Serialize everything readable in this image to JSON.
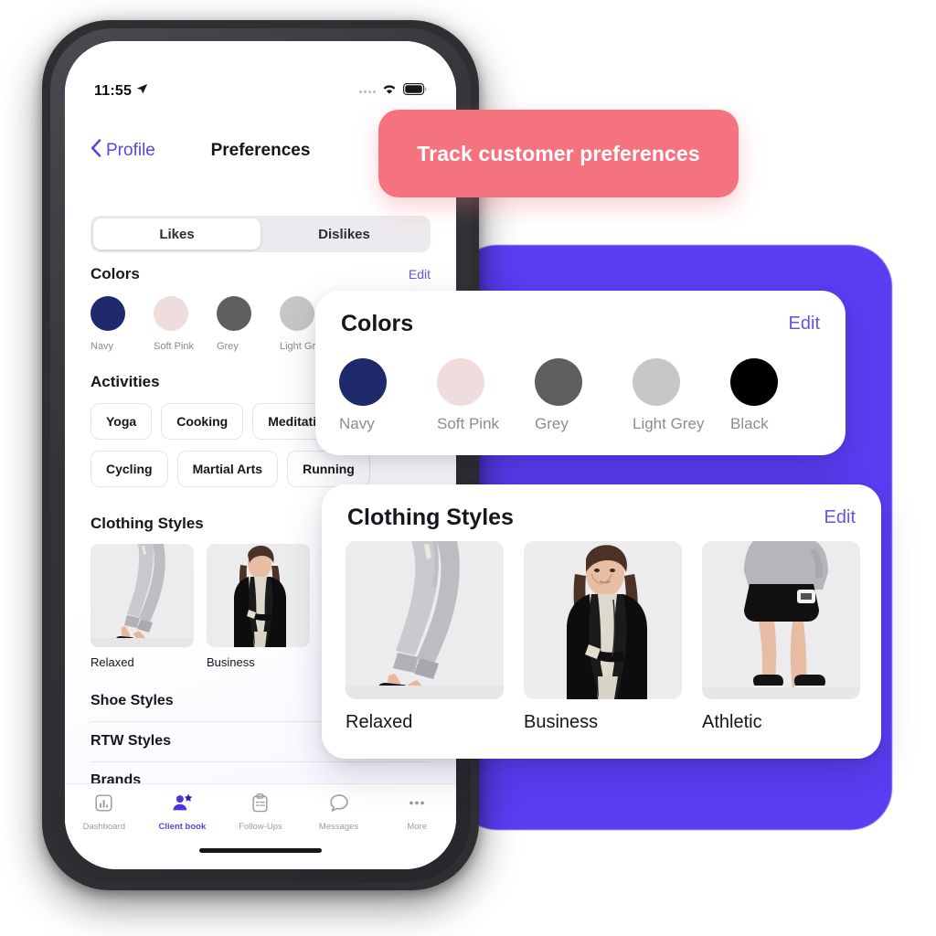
{
  "status_bar": {
    "time": "11:55",
    "location_icon": "location-arrow-icon",
    "signal_icon": "signal-dots-icon",
    "wifi_icon": "wifi-icon",
    "battery_icon": "battery-icon"
  },
  "nav": {
    "back_label": "Profile",
    "back_icon": "chevron-left-icon",
    "title": "Preferences"
  },
  "segmented": {
    "tabs": [
      {
        "label": "Likes",
        "active": true
      },
      {
        "label": "Dislikes",
        "active": false
      }
    ]
  },
  "phone_sections": {
    "colors": {
      "title": "Colors",
      "edit_label": "Edit",
      "swatches": [
        {
          "label": "Navy",
          "hex": "#1f2a6d"
        },
        {
          "label": "Soft Pink",
          "hex": "#efdcdd"
        },
        {
          "label": "Grey",
          "hex": "#5e5e5e"
        },
        {
          "label": "Light Grey",
          "hex": "#c7c7c9"
        },
        {
          "label": "Black",
          "hex": "#000000"
        }
      ]
    },
    "activities": {
      "title": "Activities",
      "chips_row1": [
        "Yoga",
        "Cooking",
        "Meditation"
      ],
      "chips_row2": [
        "Cycling",
        "Martial Arts",
        "Running"
      ]
    },
    "clothing_styles": {
      "title": "Clothing Styles",
      "edit_label": "Edit",
      "tiles": [
        {
          "caption": "Relaxed",
          "image": "grey-joggers-photo"
        },
        {
          "caption": "Business",
          "image": "black-coat-photo"
        },
        {
          "caption": "Athletic",
          "image": "black-shorts-photo"
        }
      ]
    },
    "list_rows": [
      "Shoe Styles",
      "RTW Styles",
      "Brands"
    ]
  },
  "tab_bar": {
    "items": [
      {
        "label": "Dashboard",
        "icon": "bar-chart-icon",
        "active": false
      },
      {
        "label": "Client book",
        "icon": "person-star-icon",
        "active": true
      },
      {
        "label": "Follow-Ups",
        "icon": "clipboard-icon",
        "active": false
      },
      {
        "label": "Messages",
        "icon": "speech-bubble-icon",
        "active": false
      },
      {
        "label": "More",
        "icon": "ellipsis-icon",
        "active": false
      }
    ]
  },
  "callout_banner": {
    "text": "Track customer preferences",
    "background": "#f4737f"
  },
  "colors_card": {
    "title": "Colors",
    "edit_label": "Edit",
    "swatches": [
      {
        "label": "Navy",
        "hex": "#1f2a6d"
      },
      {
        "label": "Soft Pink",
        "hex": "#efdcdd"
      },
      {
        "label": "Grey",
        "hex": "#5e5e5e"
      },
      {
        "label": "Light Grey",
        "hex": "#c7c7c9"
      },
      {
        "label": "Black",
        "hex": "#000000"
      }
    ]
  },
  "styles_card": {
    "title": "Clothing Styles",
    "edit_label": "Edit",
    "tiles": [
      {
        "caption": "Relaxed",
        "image": "grey-joggers-photo"
      },
      {
        "caption": "Business",
        "image": "black-coat-photo"
      },
      {
        "caption": "Athletic",
        "image": "black-shorts-photo"
      }
    ]
  },
  "theme": {
    "accent_purple": "#5b45e0",
    "backdrop_purple": "#5b3df2",
    "link_purple": "#6a51ec",
    "coral": "#f4737f"
  }
}
